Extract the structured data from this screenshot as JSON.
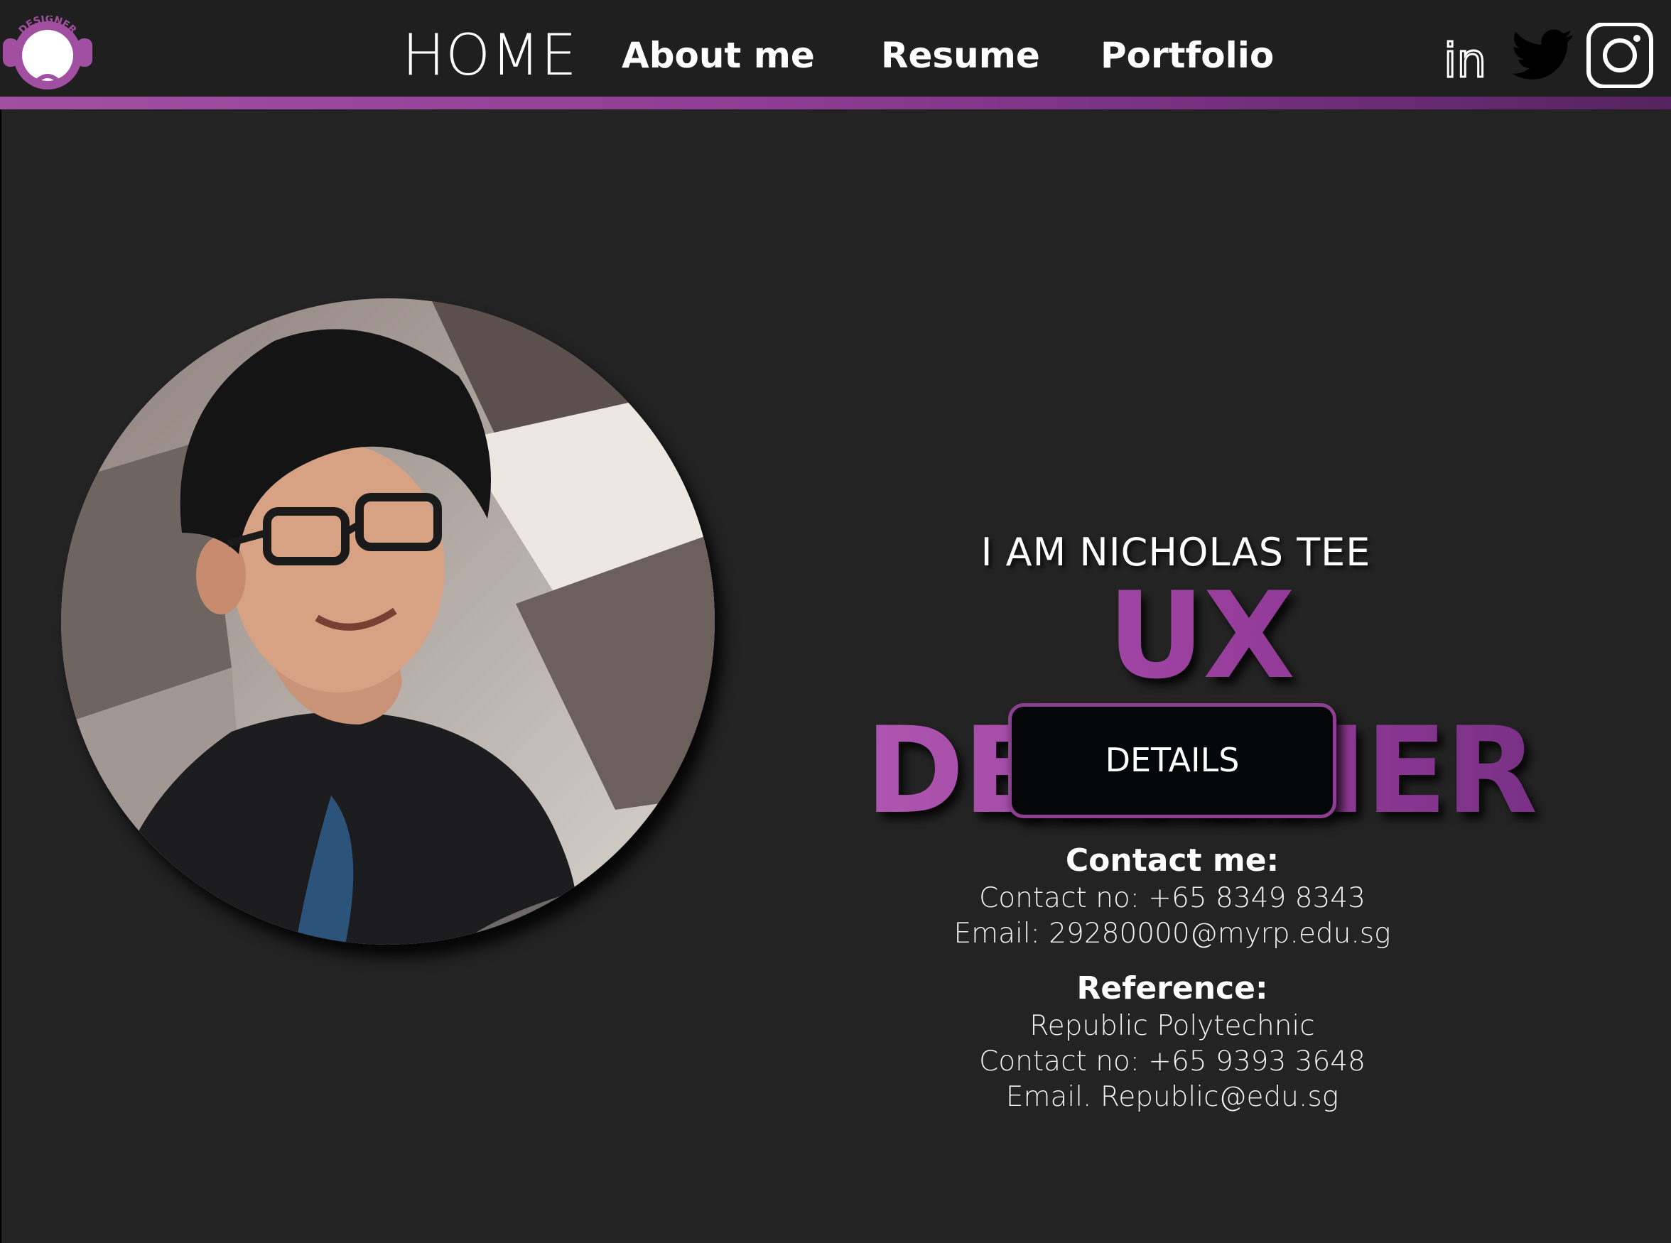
{
  "header": {
    "logo_text": "DESIGNER",
    "nav": {
      "home": "HOME",
      "about": "About me",
      "resume": "Resume",
      "portfolio": "Portfolio"
    },
    "social": {
      "linkedin_text": "in",
      "icons": [
        "linkedin-icon",
        "twitter-icon",
        "instagram-icon"
      ]
    }
  },
  "hero": {
    "intro": "I AM NICHOLAS TEE",
    "title": "UX DESIGNER",
    "details_button": "DETAILS"
  },
  "contact": {
    "heading": "Contact me:",
    "phone": "Contact no: +65 8349 8343",
    "email": "Email: 29280000@myrp.edu.sg"
  },
  "reference": {
    "heading": "Reference:",
    "name": "Republic Polytechnic",
    "phone": "Contact no: +65 9393 3648",
    "email": "Email. Republic@edu.sg"
  },
  "colors": {
    "background": "#232323",
    "header": "#1f1f1f",
    "accent": "#9a3f9e",
    "accent_dark": "#6f2b7e",
    "button": "#050607"
  }
}
